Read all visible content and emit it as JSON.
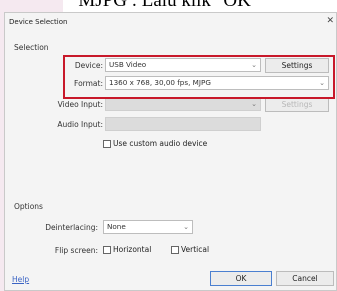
{
  "caption": "MJPG : Lalu klik \"OK\"",
  "dialog": {
    "title": "Device Selection",
    "close_icon": "close-icon",
    "selection_label": "Selection",
    "device": {
      "label": "Device:",
      "value": "USB Video"
    },
    "settings_label": "Settings",
    "format": {
      "label": "Format:",
      "value": "1360 x 768, 30,00 fps, MJPG"
    },
    "video_input": {
      "label": "Video Input:",
      "value": ""
    },
    "video_input_settings_label": "Settings",
    "audio_input": {
      "label": "Audio Input:",
      "value": ""
    },
    "custom_audio": {
      "label": "Use custom audio device",
      "checked": false
    },
    "options_label": "Options",
    "deinterlacing": {
      "label": "Deinterlacing:",
      "value": "None"
    },
    "flip_screen": {
      "label": "Flip screen:",
      "horizontal_label": "Horizontal",
      "vertical_label": "Vertical",
      "horizontal_checked": false,
      "vertical_checked": false
    },
    "help_label": "Help",
    "ok_label": "OK",
    "cancel_label": "Cancel"
  },
  "colors": {
    "highlight": "#c8182a",
    "link": "#3b64c4"
  }
}
